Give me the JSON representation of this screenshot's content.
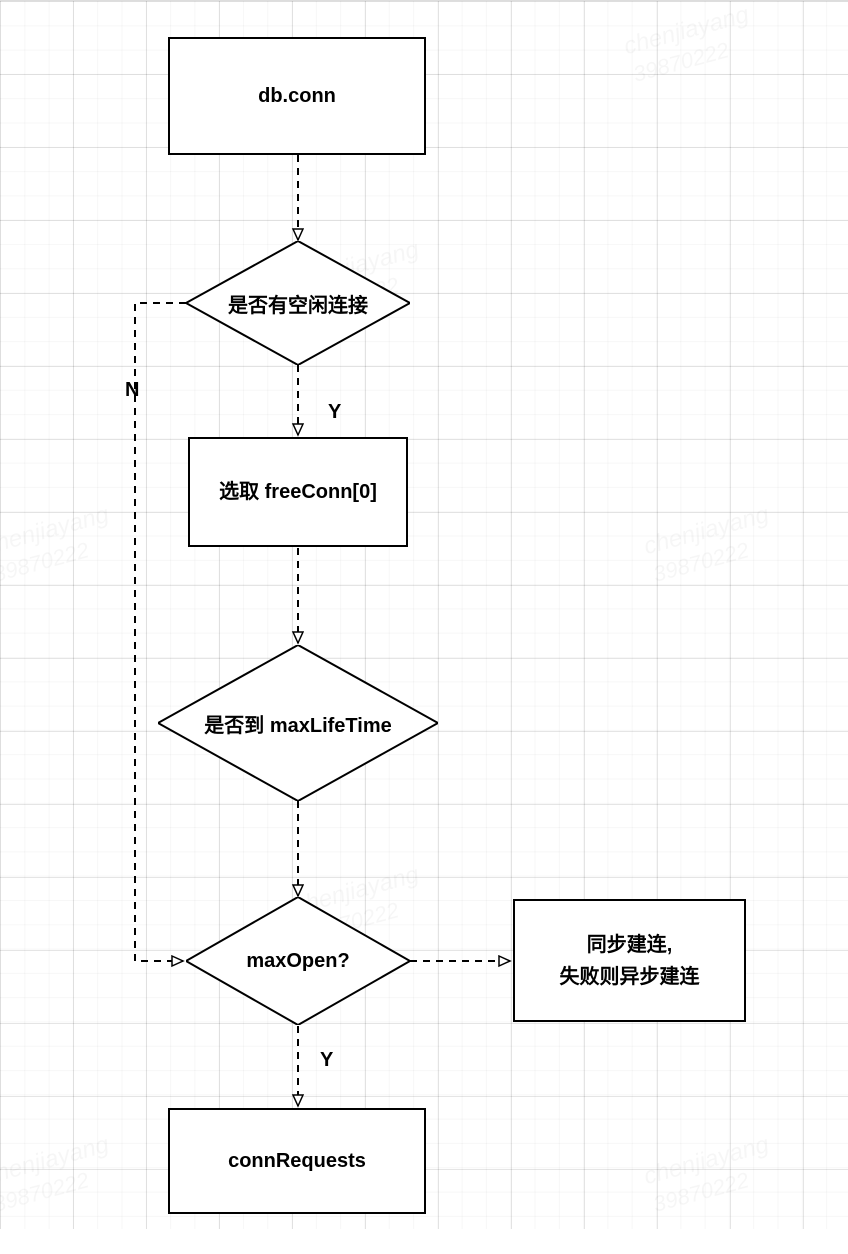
{
  "chart_data": {
    "type": "flowchart",
    "nodes": [
      {
        "id": "n1",
        "shape": "rect",
        "label": "db.conn"
      },
      {
        "id": "n2",
        "shape": "diamond",
        "label": "是否有空闲连接"
      },
      {
        "id": "n3",
        "shape": "rect",
        "label": "选取 freeConn[0]"
      },
      {
        "id": "n4",
        "shape": "diamond",
        "label": "是否到 maxLifeTime"
      },
      {
        "id": "n5",
        "shape": "diamond",
        "label": "maxOpen?"
      },
      {
        "id": "n6",
        "shape": "rect",
        "label": "同步建连,\n失败则异步建连"
      },
      {
        "id": "n7",
        "shape": "rect",
        "label": "connRequests"
      }
    ],
    "edges": [
      {
        "from": "n1",
        "to": "n2",
        "style": "dashed",
        "arrow": "open",
        "label": ""
      },
      {
        "from": "n2",
        "to": "n3",
        "style": "dashed",
        "arrow": "open",
        "label": "Y"
      },
      {
        "from": "n3",
        "to": "n4",
        "style": "dashed",
        "arrow": "open",
        "label": ""
      },
      {
        "from": "n4",
        "to": "n5",
        "style": "dashed",
        "arrow": "open",
        "label": ""
      },
      {
        "from": "n5",
        "to": "n7",
        "style": "dashed",
        "arrow": "open",
        "label": "Y"
      },
      {
        "from": "n5",
        "to": "n6",
        "style": "dashed",
        "arrow": "open",
        "label": ""
      },
      {
        "from": "n2",
        "to": "n5",
        "style": "dashed",
        "arrow": "open",
        "label": "N",
        "routing": "left-elbow"
      }
    ]
  },
  "nodes": {
    "n1": "db.conn",
    "n2": "是否有空闲连接",
    "n3": "选取 freeConn[0]",
    "n4": "是否到 maxLifeTime",
    "n5": "maxOpen?",
    "n6_line1": "同步建连,",
    "n6_line2": "失败则异步建连",
    "n7": "connRequests"
  },
  "labels": {
    "yes1": "Y",
    "yes2": "Y",
    "no": "N"
  },
  "watermark": {
    "line1": "chenjiayang",
    "line2": "39870222"
  }
}
